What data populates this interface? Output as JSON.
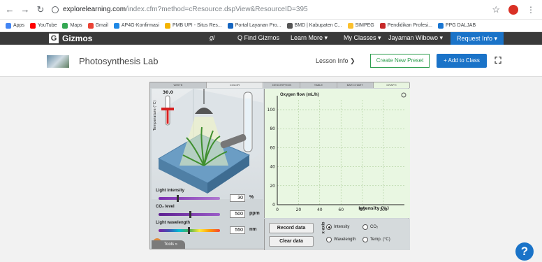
{
  "browser": {
    "url_host": "explorelearning.com",
    "url_path": "/index.cfm?method=cResource.dspView&ResourceID=395",
    "bookmarks": [
      {
        "label": "Apps",
        "color": "#4285f4"
      },
      {
        "label": "YouTube",
        "color": "#ff0000"
      },
      {
        "label": "Maps",
        "color": "#34a853"
      },
      {
        "label": "Gmail",
        "color": "#ea4335"
      },
      {
        "label": "AP4G-Konfirmasi",
        "color": "#1e88e5"
      },
      {
        "label": "PMB UPI - Situs Res...",
        "color": "#f4b400"
      },
      {
        "label": "Portal Layanan Pro...",
        "color": "#1565c0"
      },
      {
        "label": "BMD | Kabupaten C...",
        "color": "#555555"
      },
      {
        "label": "SIMPEG",
        "color": "#fbc02d"
      },
      {
        "label": "Pendidikan Profesi...",
        "color": "#c62828"
      },
      {
        "label": "PPG DALJAB",
        "color": "#1976d2"
      }
    ]
  },
  "gizmos_nav": {
    "logo": "Gizmos",
    "logo_letter": "G",
    "signature": "gl",
    "find": "Q Find Gizmos",
    "learn_more": "Learn More ▾",
    "my_classes": "My Classes ▾",
    "user": "Jayaman Wibowo ▾",
    "request_info": "Request Info ▾"
  },
  "title_bar": {
    "title": "Photosynthesis Lab",
    "lesson_info": "Lesson Info ❯",
    "create_preset": "Create New Preset",
    "add_to_class": "+ Add to Class"
  },
  "sim": {
    "left_tabs": [
      {
        "label": "WHITE",
        "active": false
      },
      {
        "label": "COLOR",
        "active": true
      }
    ],
    "right_tabs": [
      {
        "label": "DESCRIPTION",
        "active": false
      },
      {
        "label": "TABLE",
        "active": false
      },
      {
        "label": "BAR CHART",
        "active": false
      },
      {
        "label": "GRAPH",
        "active": true
      }
    ],
    "temperature": {
      "label": "Temperature (°C)",
      "value": "30.0",
      "level": 0.55
    },
    "controls": [
      {
        "label": "Light intensity",
        "value": "30",
        "unit": "%",
        "position": 0.3
      },
      {
        "label": "CO₂ level",
        "value": "500",
        "unit": "ppm",
        "position": 0.5
      },
      {
        "label": "Light wavelength",
        "value": "550",
        "unit": "nm",
        "position": 0.48
      }
    ],
    "tools_label": "Tools »",
    "graph": {
      "y_label": "Oxygen flow (mL/h)",
      "x_label": "Intensity (%)",
      "x_ticks": [
        "0",
        "20",
        "40",
        "60",
        "80",
        "100"
      ],
      "y_ticks": [
        "0",
        "20",
        "40",
        "60",
        "80",
        "100"
      ]
    },
    "record_btn": "Record data",
    "clear_btn": "Clear data",
    "x_axis_label": "x-axis",
    "radios": [
      {
        "label": "Intensity",
        "on": true
      },
      {
        "label": "CO₂",
        "on": false
      },
      {
        "label": "Wavelength",
        "on": false
      },
      {
        "label": "Temp. (°C)",
        "on": false
      }
    ]
  },
  "help_label": "?"
}
